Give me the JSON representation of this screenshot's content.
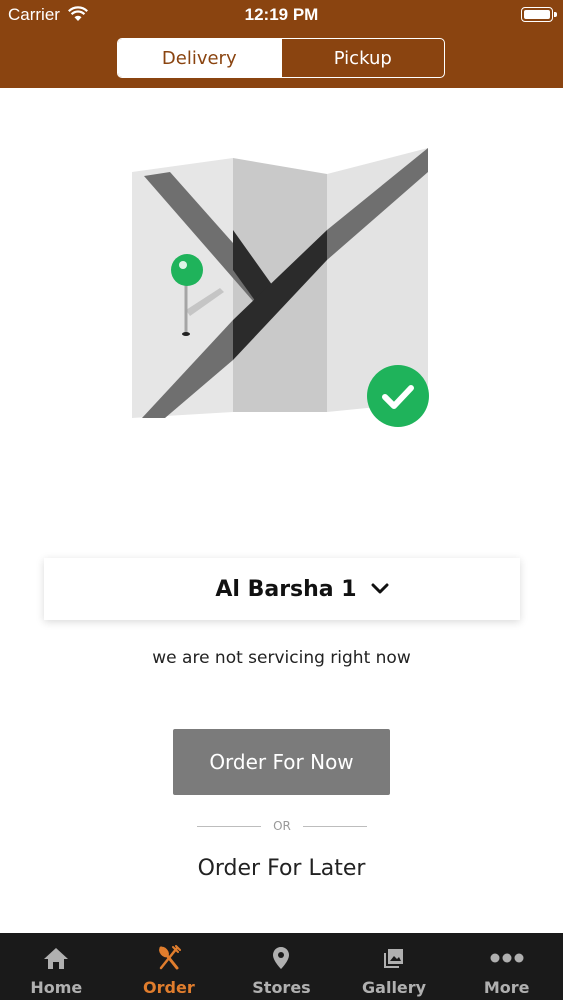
{
  "status_bar": {
    "carrier": "Carrier",
    "time": "12:19 PM"
  },
  "mode_toggle": {
    "options": [
      "Delivery",
      "Pickup"
    ],
    "selected": "Delivery"
  },
  "location": {
    "name": "Al Barsha 1"
  },
  "service_message": "we are not servicing right now",
  "actions": {
    "order_now": "Order For Now",
    "or": "OR",
    "order_later": "Order For Later"
  },
  "tabs": [
    {
      "label": "Home",
      "icon": "home-icon"
    },
    {
      "label": "Order",
      "icon": "fork-knife-icon",
      "active": true
    },
    {
      "label": "Stores",
      "icon": "location-pin-icon"
    },
    {
      "label": "Gallery",
      "icon": "gallery-icon"
    },
    {
      "label": "More",
      "icon": "more-dots-icon"
    }
  ],
  "colors": {
    "header": "#8a4410",
    "accent": "#e07d2d",
    "button": "#7b7b7b",
    "check": "#1fb35b"
  }
}
